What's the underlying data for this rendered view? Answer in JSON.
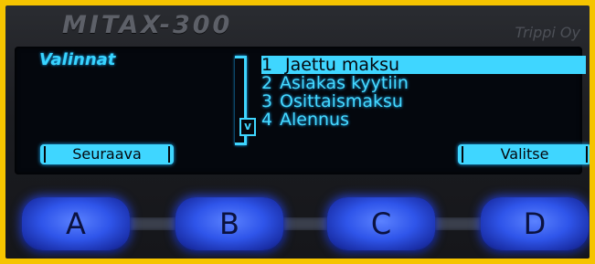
{
  "device": {
    "brand": "MITAX-300",
    "maker": "Trippi Oy"
  },
  "screen": {
    "title": "Valinnat",
    "scroll_indicator": "v",
    "menu": [
      {
        "num": "1",
        "label": "Jaettu maksu",
        "selected": true
      },
      {
        "num": "2",
        "label": "Asiakas kyytiin",
        "selected": false
      },
      {
        "num": "3",
        "label": "Osittaismaksu",
        "selected": false
      },
      {
        "num": "4",
        "label": "Alennus",
        "selected": false
      }
    ],
    "softkeys": {
      "left": "Seuraava",
      "right": "Valitse"
    }
  },
  "keys": [
    "A",
    "B",
    "C",
    "D"
  ],
  "colors": {
    "frame": "#f5c400",
    "display_text": "#3fd6ff",
    "key_glow": "#2f55ea"
  },
  "icons": {
    "scroll": "scroll-down-icon"
  }
}
